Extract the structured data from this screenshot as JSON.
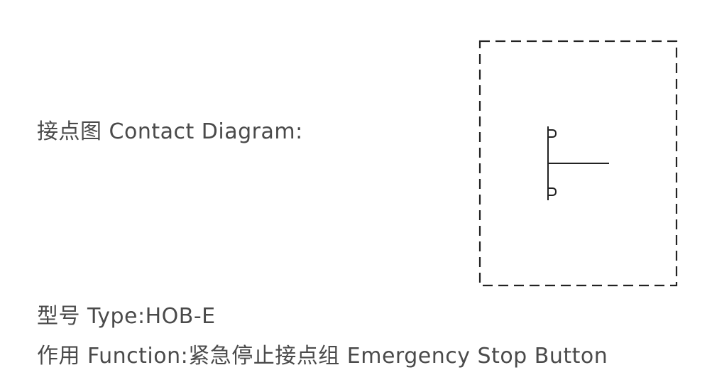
{
  "contact_diagram_label": "接点图 Contact Diagram:",
  "type": {
    "label": "型号 Type:",
    "value": "HOB-E"
  },
  "function": {
    "label": "作用 Function:",
    "value": "紧急停止接点组 Emergency Stop Button"
  },
  "colors": {
    "text": "#4a4a4a",
    "stroke": "#222222",
    "background": "#ffffff"
  }
}
